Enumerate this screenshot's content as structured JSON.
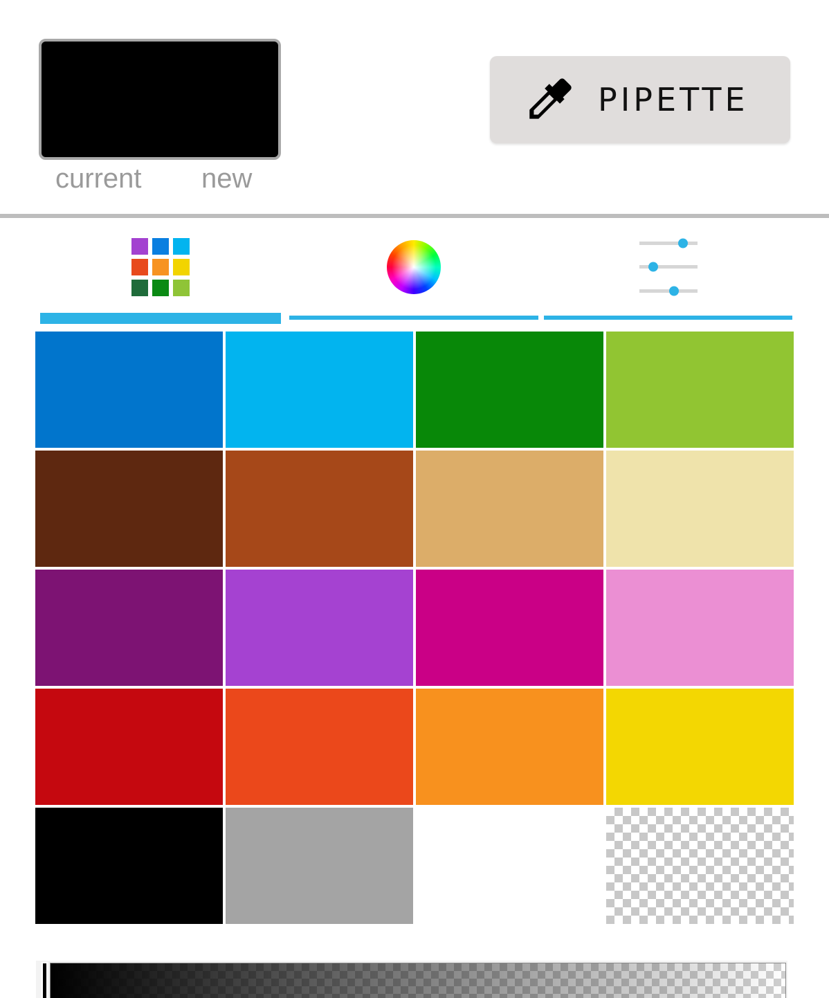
{
  "preview": {
    "current_label": "current",
    "new_label": "new",
    "current_color": "#000000",
    "new_color": "#000000"
  },
  "pipette": {
    "label": "PIPETTE",
    "icon": "eyedropper-icon"
  },
  "tabs": [
    {
      "icon": "swatch-grid-icon",
      "selected": true
    },
    {
      "icon": "color-wheel-icon",
      "selected": false
    },
    {
      "icon": "sliders-icon",
      "selected": false
    }
  ],
  "tab_icon_colors": {
    "grid": [
      "#a342d0",
      "#0a7fe0",
      "#02b4ef",
      "#e84a1d",
      "#f79321",
      "#f2d400",
      "#1f6b3a",
      "#0b8a14",
      "#8fc437"
    ],
    "slider_accent": "#2db3e6"
  },
  "swatches": [
    "#0175cc",
    "#02b4ef",
    "#088808",
    "#91c532",
    "#5e2810",
    "#a64819",
    "#dcad69",
    "#efe3ab",
    "#7d1373",
    "#a542d1",
    "#ca0086",
    "#eb8fd3",
    "#c5080f",
    "#eb481b",
    "#f8911e",
    "#f3d702",
    "#000000",
    "#a4a4a4",
    "#ffffff",
    "transparent"
  ],
  "alpha": {
    "value": 1.0
  },
  "colors": {
    "accent": "#2db3e6",
    "button_bg": "#e0dddc",
    "divider": "#bdbdbd",
    "label_gray": "#9a9a9a"
  }
}
